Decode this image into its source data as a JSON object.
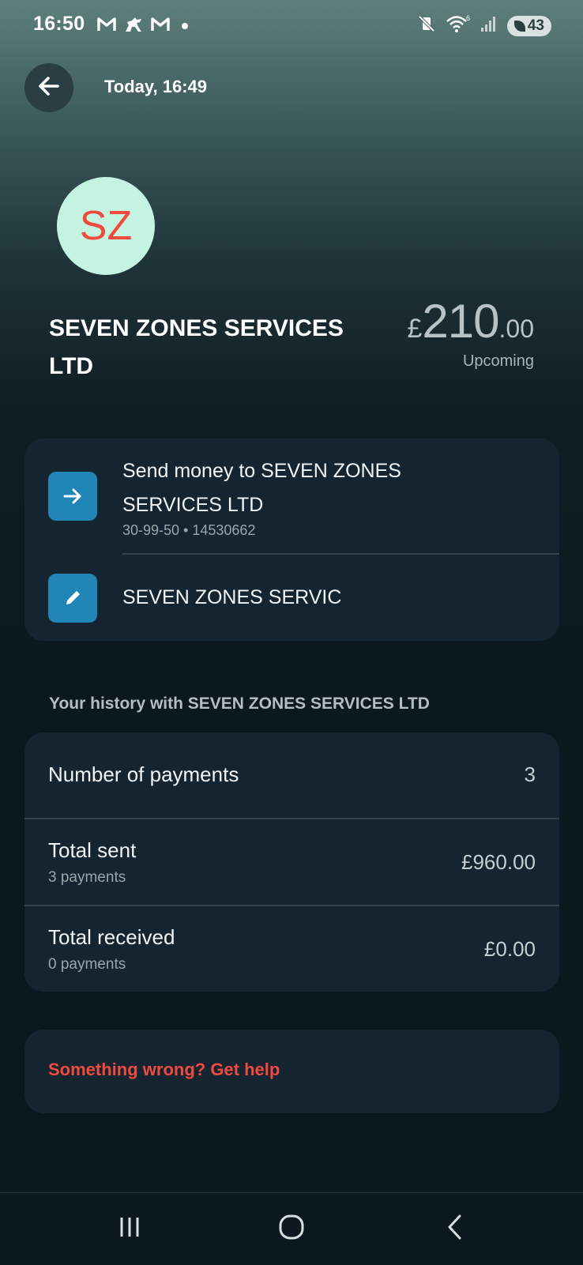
{
  "status_bar": {
    "time": "16:50",
    "left_icons": [
      "gmail-m-icon",
      "horse-icon",
      "gmail-m-icon",
      "dot-icon"
    ],
    "right_icons": [
      "mute-vibrate-icon",
      "wifi-6-icon",
      "signal-icon"
    ],
    "battery": "43"
  },
  "header": {
    "back_icon": "arrow-left-icon",
    "timestamp": "Today, 16:49"
  },
  "transaction": {
    "avatar_initials": "SZ",
    "merchant_name": "SEVEN ZONES SERVICES LTD",
    "amount_currency": "£",
    "amount_major": "210",
    "amount_minor": ".00",
    "status": "Upcoming"
  },
  "actions": [
    {
      "icon": "arrow-right-icon",
      "label": "Send money to SEVEN ZONES SERVICES LTD",
      "sub": "30-99-50 • 14530662"
    },
    {
      "icon": "pencil-icon",
      "label": "SEVEN ZONES SERVIC"
    }
  ],
  "history": {
    "heading": "Your history with SEVEN ZONES SERVICES LTD",
    "rows": [
      {
        "label": "Number of payments",
        "sub": "",
        "value": "3"
      },
      {
        "label": "Total sent",
        "sub": "3 payments",
        "value": "£960.00"
      },
      {
        "label": "Total received",
        "sub": "0 payments",
        "value": "£0.00"
      }
    ]
  },
  "help": {
    "label": "Something wrong? Get help"
  },
  "nav": {
    "icons": [
      "recent-apps-icon",
      "home-icon",
      "back-icon"
    ]
  },
  "colors": {
    "accent_blue": "#2185b8",
    "avatar_bg": "#c4f3e2",
    "avatar_text": "#ef4a3d",
    "help_text": "#ef4a3d",
    "card_bg": "#142431"
  }
}
